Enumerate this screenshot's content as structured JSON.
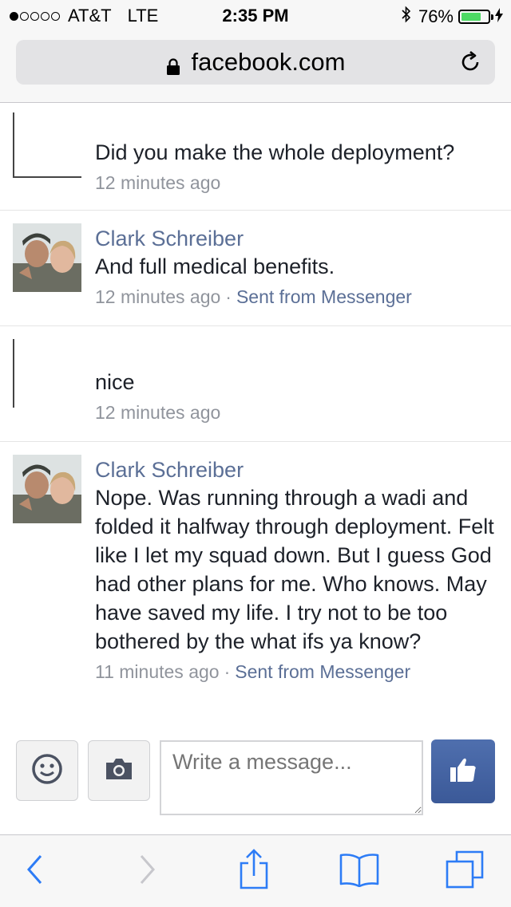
{
  "status_bar": {
    "signal_bars_filled": 1,
    "signal_bars_total": 5,
    "carrier": "AT&T",
    "network": "LTE",
    "time": "2:35 PM",
    "battery_percent": "76%",
    "battery_level": 0.76
  },
  "browser": {
    "url": "facebook.com"
  },
  "messages": [
    {
      "sender": "",
      "text": "Did you make the whole deployment?",
      "time": "12 minutes ago",
      "via": ""
    },
    {
      "sender": "Clark Schreiber",
      "text": "And full medical benefits.",
      "time": "12 minutes ago",
      "separator": "·",
      "via": "Sent from Messenger"
    },
    {
      "sender": "",
      "text": "nice",
      "time": "12 minutes ago",
      "via": ""
    },
    {
      "sender": "Clark Schreiber",
      "text": "Nope. Was running through a wadi and folded it halfway through deployment. Felt like I let my squad down. But I guess God had other plans for me. Who knows. May have saved my life. I try not to be too bothered by the what ifs ya know?",
      "time": "11 minutes ago",
      "separator": "·",
      "via": "Sent from Messenger"
    }
  ],
  "composer": {
    "placeholder": "Write a message..."
  },
  "colors": {
    "link_blue": "#5b6f96",
    "facebook_blue": "#3b5998",
    "ios_blue": "#2d7cf6",
    "battery_green": "#4cd964"
  },
  "icons": {
    "emoji": "smiley-icon",
    "camera": "camera-icon",
    "like": "thumbs-up-icon",
    "toolbar": [
      "back-chevron-icon",
      "forward-chevron-icon",
      "share-icon",
      "bookmarks-icon",
      "tabs-icon"
    ]
  }
}
